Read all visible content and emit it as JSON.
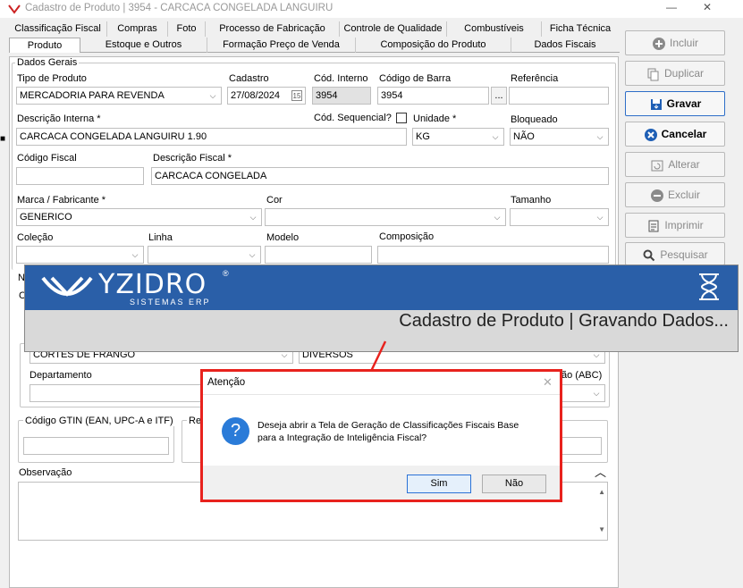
{
  "window": {
    "title": "Cadastro de Produto | 3954 - CARCACA CONGELADA LANGUIRU",
    "minimize": "—",
    "maximize": "☐",
    "close": "✕"
  },
  "tabs_row1": [
    "Classificação Fiscal",
    "Compras",
    "Foto",
    "Processo de Fabricação",
    "Controle de Qualidade",
    "Combustíveis",
    "Ficha Técnica"
  ],
  "tabs_row2": [
    "Produto",
    "Estoque e Outros",
    "Formação Preço de Venda",
    "Composição do Produto",
    "Dados Fiscais"
  ],
  "form": {
    "dados_gerais": "Dados Gerais",
    "tipo_produto": {
      "label": "Tipo de Produto",
      "value": "MERCADORIA PARA REVENDA"
    },
    "cadastro": {
      "label": "Cadastro",
      "value": "27/08/2024"
    },
    "cod_interno": {
      "label": "Cód. Interno",
      "value": "3954"
    },
    "codigo_barra": {
      "label": "Código de Barra",
      "value": "3954",
      "button": "..."
    },
    "referencia": {
      "label": "Referência",
      "value": ""
    },
    "descricao_interna": {
      "label": "Descrição Interna *",
      "value": "CARCACA CONGELADA LANGUIRU 1.90"
    },
    "cod_sequencial": {
      "label": "Cód. Sequencial?"
    },
    "unidade": {
      "label": "Unidade *",
      "value": "KG"
    },
    "bloqueado": {
      "label": "Bloqueado",
      "value": "NÃO"
    },
    "codigo_fiscal": {
      "label": "Código Fiscal",
      "value": ""
    },
    "descricao_fiscal": {
      "label": "Descrição Fiscal *",
      "value": "CARCACA CONGELADA"
    },
    "marca": {
      "label": "Marca / Fabricante *",
      "value": "GENERICO"
    },
    "cor": {
      "label": "Cor",
      "value": ""
    },
    "tamanho": {
      "label": "Tamanho",
      "value": ""
    },
    "colecao": {
      "label": "Coleção",
      "value": ""
    },
    "linha": {
      "label": "Linha",
      "value": ""
    },
    "modelo": {
      "label": "Modelo",
      "value": ""
    },
    "composicao": {
      "label": "Composição",
      "value": ""
    },
    "grupo_value": "CORTES DE FRANGO",
    "subgrupo_value": "DIVERSOS",
    "departamento": {
      "label": "Departamento",
      "value": ""
    },
    "abc_label": "ão (ABC)",
    "gtin": {
      "label": "Código GTIN (EAN, UPC-A e ITF)",
      "value": ""
    },
    "reg_label": "Reg",
    "observacao": {
      "label": "Observação",
      "value": ""
    },
    "left_frag_n": "N",
    "left_frag_c": "C"
  },
  "sidebar": [
    "Incluir",
    "Duplicar",
    "Gravar",
    "Cancelar",
    "Alterar",
    "Excluir",
    "Imprimir",
    "Pesquisar"
  ],
  "banner": {
    "logo": "YZIDRO",
    "logo_sub": "SISTEMAS ERP",
    "reg": "®",
    "message": "Cadastro de Produto | Gravando Dados..."
  },
  "dialog": {
    "title": "Atenção",
    "message_line1": "Deseja abrir a Tela de Geração de Classificações Fiscais Base",
    "message_line2": "para a Integração de Inteligência Fiscal?",
    "yes": "Sim",
    "no": "Não",
    "icon": "?"
  }
}
